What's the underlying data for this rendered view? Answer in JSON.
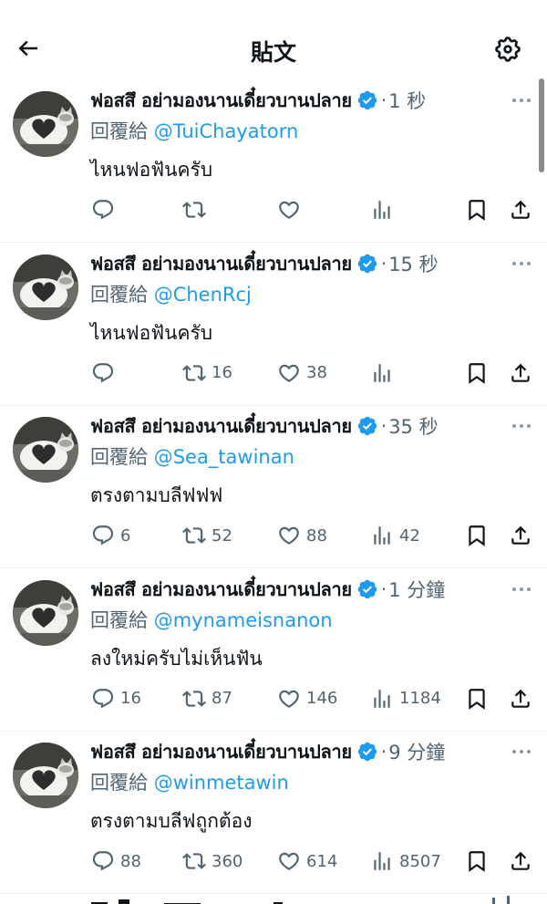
{
  "header": {
    "title": "貼文"
  },
  "reply_prefix": "回覆給",
  "tweets": [
    {
      "name": "ฟอสสึ อย่ามองนานเดี๋ยวบานปลาย",
      "time": "1 秒",
      "handle": "@TuiChayatorn",
      "text": "ไหนฟอฟันครับ",
      "replies": "",
      "retweets": "",
      "likes": "",
      "views": ""
    },
    {
      "name": "ฟอสสึ อย่ามองนานเดี๋ยวบานปลาย",
      "time": "15 秒",
      "handle": "@ChenRcj",
      "text": "ไหนฟอฟันครับ",
      "replies": "",
      "retweets": "16",
      "likes": "38",
      "views": ""
    },
    {
      "name": "ฟอสสึ อย่ามองนานเดี๋ยวบานปลาย",
      "time": "35 秒",
      "handle": "@Sea_tawinan",
      "text": "ตรงตามบลีฟฟฟ",
      "replies": "6",
      "retweets": "52",
      "likes": "88",
      "views": "42"
    },
    {
      "name": "ฟอสสึ อย่ามองนานเดี๋ยวบานปลาย",
      "time": "1 分鐘",
      "handle": "@mynameisnanon",
      "text": "ลงใหม่ครับไม่เห็นฟัน",
      "replies": "16",
      "retweets": "87",
      "likes": "146",
      "views": "1184"
    },
    {
      "name": "ฟอสสึ อย่ามองนานเดี๋ยวบานปลาย",
      "time": "9 分鐘",
      "handle": "@winmetawin",
      "text": "ตรงตามบลีฟถูกต้อง",
      "replies": "88",
      "retweets": "360",
      "likes": "614",
      "views": "8507"
    }
  ],
  "colors": {
    "accent": "#1d9bf0",
    "secondary_text": "#536471",
    "primary_text": "#0f1419",
    "divider": "#eff3f4"
  }
}
